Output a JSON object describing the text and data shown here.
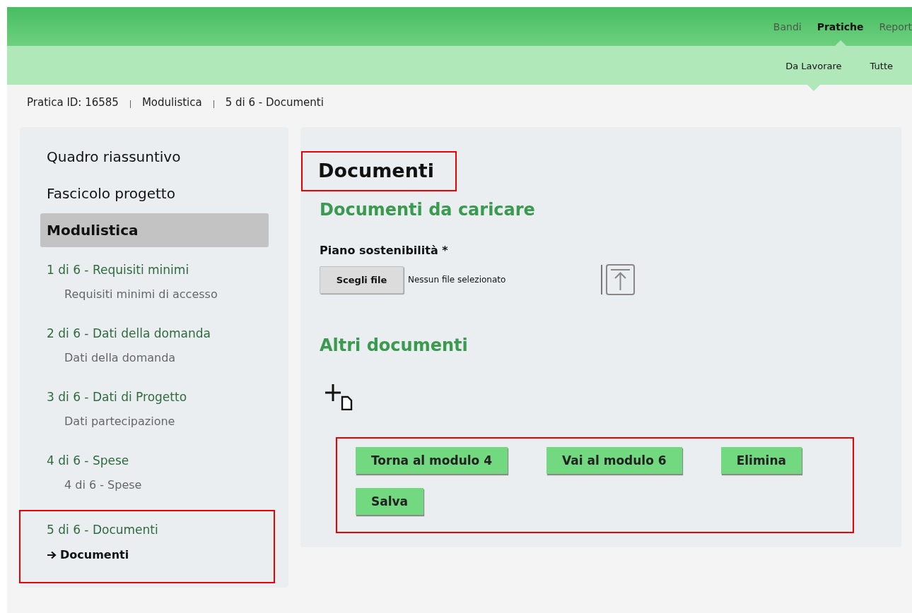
{
  "top_nav": [
    {
      "label": "Bandi",
      "selected": false
    },
    {
      "label": "Pratiche",
      "selected": true
    },
    {
      "label": "Report",
      "selected": false
    }
  ],
  "sub_nav": [
    {
      "label": "Da Lavorare",
      "selected": true
    },
    {
      "label": "Tutte",
      "selected": false
    }
  ],
  "breadcrumb": [
    "Pratica ID: 16585",
    "Modulistica",
    "5 di 6 - Documenti"
  ],
  "sidebar": {
    "items": [
      {
        "label": "Quadro riassuntivo",
        "selected": false
      },
      {
        "label": "Fascicolo progetto",
        "selected": false
      },
      {
        "label": "Modulistica",
        "selected": true
      }
    ],
    "steps": [
      {
        "title": "1 di 6 - Requisiti minimi",
        "sub": "Requisiti minimi di accesso",
        "current": false,
        "highlighted": false
      },
      {
        "title": "2 di 6 - Dati della domanda",
        "sub": "Dati della domanda",
        "current": false,
        "highlighted": false
      },
      {
        "title": "3 di 6 - Dati di Progetto",
        "sub": "Dati partecipazione",
        "current": false,
        "highlighted": false
      },
      {
        "title": "4 di 6 - Spese",
        "sub": "4 di 6 - Spese",
        "current": false,
        "highlighted": false
      },
      {
        "title": "5 di 6 - Documenti",
        "sub": "Documenti",
        "current": true,
        "highlighted": true
      }
    ]
  },
  "main": {
    "title": "Documenti",
    "title_highlighted": true,
    "section_1": "Documenti da caricare",
    "file_field": {
      "label": "Piano sostenibilità *",
      "button": "Scegli file",
      "status": "Nessun file selezionato"
    },
    "section_2": "Altri documenti",
    "buttons_highlighted": true,
    "buttons": [
      "Torna al modulo 4",
      "Vai al modulo 6",
      "Elimina",
      "Salva"
    ]
  }
}
